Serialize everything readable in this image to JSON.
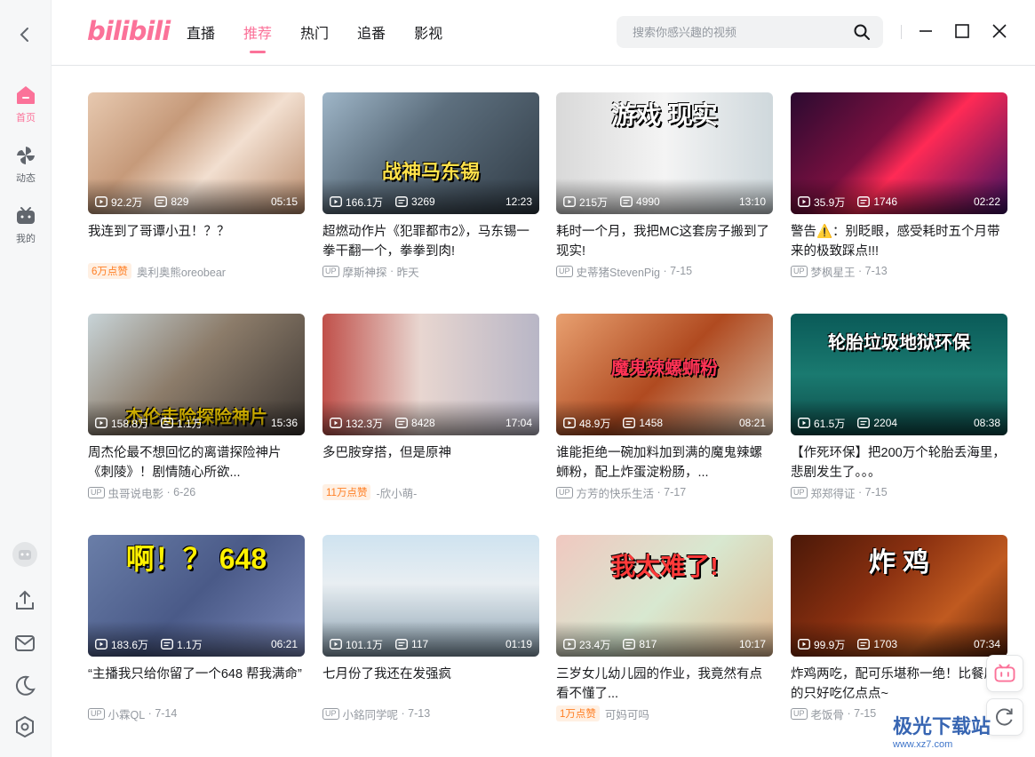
{
  "sidebar": {
    "items": [
      {
        "label": "首页",
        "icon": "home-icon"
      },
      {
        "label": "动态",
        "icon": "pinwheel-icon"
      },
      {
        "label": "我的",
        "icon": "tv-icon"
      }
    ]
  },
  "header": {
    "logo": "bilibili",
    "tabs": [
      "直播",
      "推荐",
      "热门",
      "追番",
      "影视"
    ],
    "active_tab": "推荐",
    "search_placeholder": "搜索你感兴趣的视频"
  },
  "colors": {
    "accent": "#fb7299",
    "likes": "#ff7f24"
  },
  "videos": [
    {
      "views": "92.2万",
      "danmaku": "829",
      "duration": "05:15",
      "title": "我连到了哥谭小丑！？？",
      "likes": "6万点赞",
      "author": "奥利奥熊oreobear",
      "date": "",
      "caption": ""
    },
    {
      "views": "166.1万",
      "danmaku": "3269",
      "duration": "12:23",
      "title": "超燃动作片《犯罪都市2》，马东锡一拳干翻一个，拳拳到肉!",
      "likes": "",
      "author": "摩斯神探",
      "date": "昨天",
      "caption": "战神马东锡"
    },
    {
      "views": "215万",
      "danmaku": "4990",
      "duration": "13:10",
      "title": "耗时一个月，我把MC这套房子搬到了现实!",
      "likes": "",
      "author": "史蒂猪StevenPig",
      "date": "7-15",
      "caption": "游戏 现实"
    },
    {
      "views": "35.9万",
      "danmaku": "1746",
      "duration": "02:22",
      "title": "警告⚠️：别眨眼，感受耗时五个月带来的极致踩点!!!",
      "likes": "",
      "author": "梦枫星王",
      "date": "7-13",
      "caption": ""
    },
    {
      "views": "158.8万",
      "danmaku": "1.1万",
      "duration": "15:36",
      "title": "周杰伦最不想回忆的离谱探险神片《刺陵》！剧情随心所欲...",
      "likes": "",
      "author": "虫哥说电影",
      "date": "6-26",
      "caption": "杰伦走险探险神片"
    },
    {
      "views": "132.3万",
      "danmaku": "8428",
      "duration": "17:04",
      "title": "多巴胺穿搭，但是原神",
      "likes": "11万点赞",
      "author": "-欣小萌-",
      "date": "",
      "caption": ""
    },
    {
      "views": "48.9万",
      "danmaku": "1458",
      "duration": "08:21",
      "title": "谁能拒绝一碗加料加到满的魔鬼辣螺蛳粉，配上炸蛋淀粉肠，...",
      "likes": "",
      "author": "方芳的快乐生活",
      "date": "7-17",
      "caption": "魔鬼辣螺蛳粉"
    },
    {
      "views": "61.5万",
      "danmaku": "2204",
      "duration": "08:38",
      "title": "【作死环保】把200万个轮胎丢海里，悲剧发生了。。。",
      "likes": "",
      "author": "郑郑得证",
      "date": "7-15",
      "caption": "轮胎垃圾地狱环保"
    },
    {
      "views": "183.6万",
      "danmaku": "1.1万",
      "duration": "06:21",
      "title": "“主播我只给你留了一个648 帮我满命”",
      "likes": "",
      "author": "小霖QL",
      "date": "7-14",
      "caption": "啊！？ 648"
    },
    {
      "views": "101.1万",
      "danmaku": "117",
      "duration": "01:19",
      "title": "七月份了我还在发强疯",
      "likes": "",
      "author": "小銘同学呢",
      "date": "7-13",
      "caption": ""
    },
    {
      "views": "23.4万",
      "danmaku": "817",
      "duration": "10:17",
      "title": "三岁女儿幼儿园的作业，我竟然有点看不懂了...",
      "likes": "1万点赞",
      "author": "可妈可吗",
      "date": "",
      "caption": "我太难了!"
    },
    {
      "views": "99.9万",
      "danmaku": "1703",
      "duration": "07:34",
      "title": "炸鸡两吃，配可乐堪称一绝！比餐厅的只好吃亿点点~",
      "likes": "",
      "author": "老饭骨",
      "date": "7-15",
      "caption": "炸 鸡"
    }
  ],
  "watermark": {
    "name": "极光下载站",
    "url": "www.xz7.com"
  }
}
